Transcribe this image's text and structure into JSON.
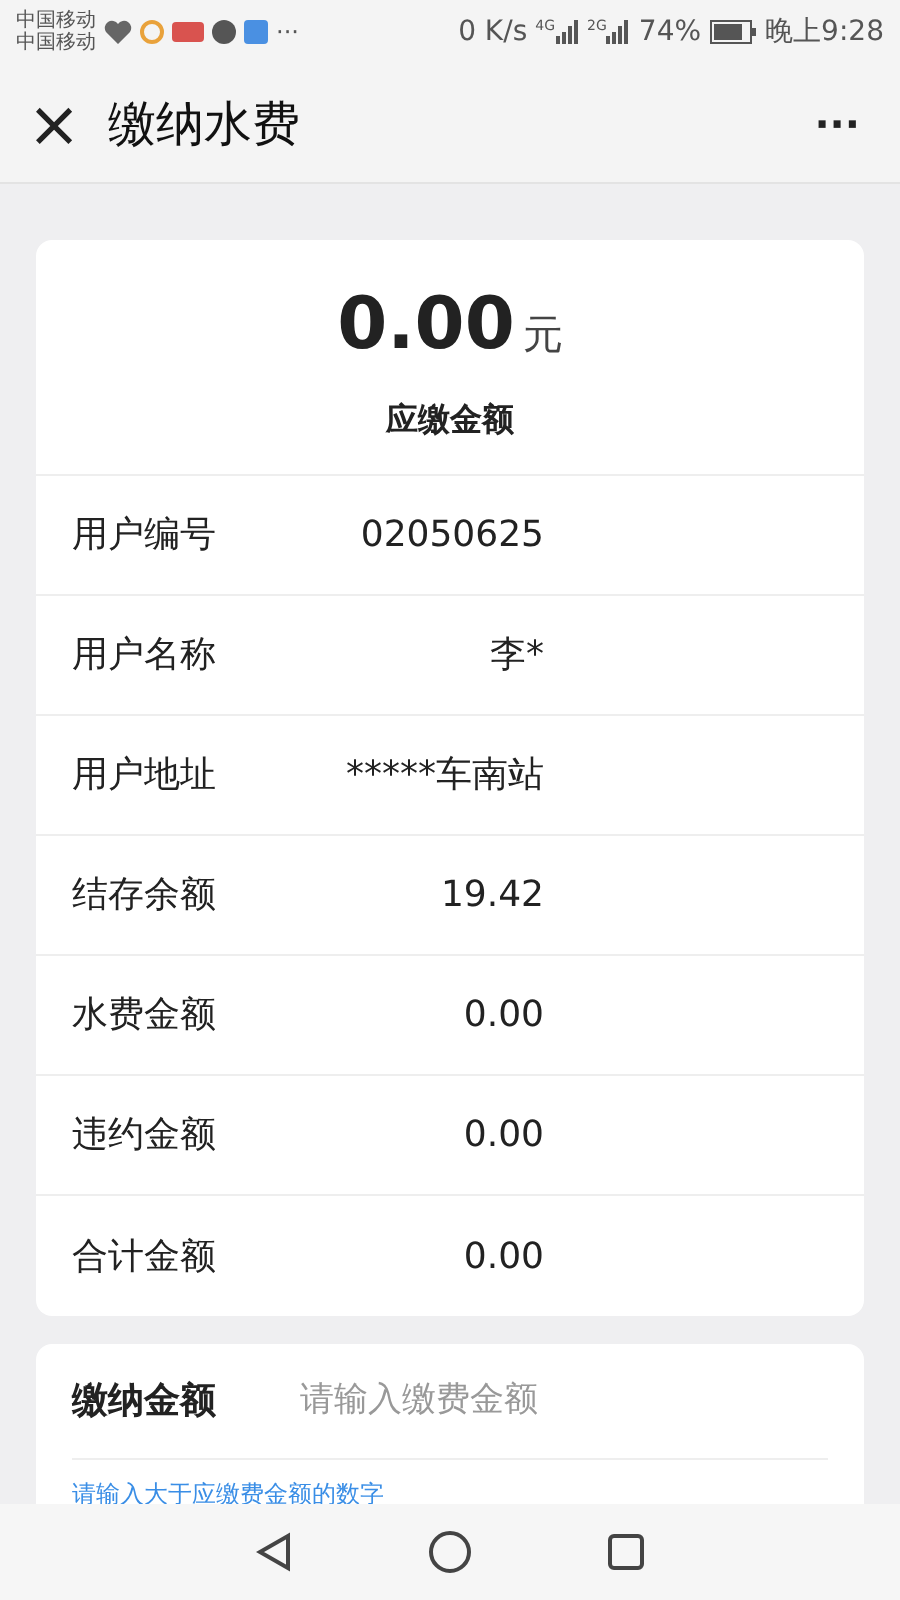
{
  "status_bar": {
    "carriers": [
      "中国移动",
      "中国移动"
    ],
    "more": "···",
    "speed": "0 K/s",
    "networks": [
      "4G",
      "2G"
    ],
    "battery": "74%",
    "time": "晚上9:28"
  },
  "title_bar": {
    "close": "×",
    "title": "缴纳水费",
    "more": "···"
  },
  "summary": {
    "amount": "0.00",
    "unit": "元",
    "label": "应缴金额"
  },
  "rows": [
    {
      "label": "用户编号",
      "value": "02050625"
    },
    {
      "label": "用户名称",
      "value": "李*"
    },
    {
      "label": "用户地址",
      "value": "*****车南站"
    },
    {
      "label": "结存余额",
      "value": "19.42"
    },
    {
      "label": "水费金额",
      "value": "0.00"
    },
    {
      "label": "违约金额",
      "value": "0.00"
    },
    {
      "label": "合计金额",
      "value": "0.00"
    }
  ],
  "payment": {
    "label": "缴纳金额",
    "placeholder": "请输入缴费金额",
    "hint": "请输入大于应缴费金额的数字"
  }
}
